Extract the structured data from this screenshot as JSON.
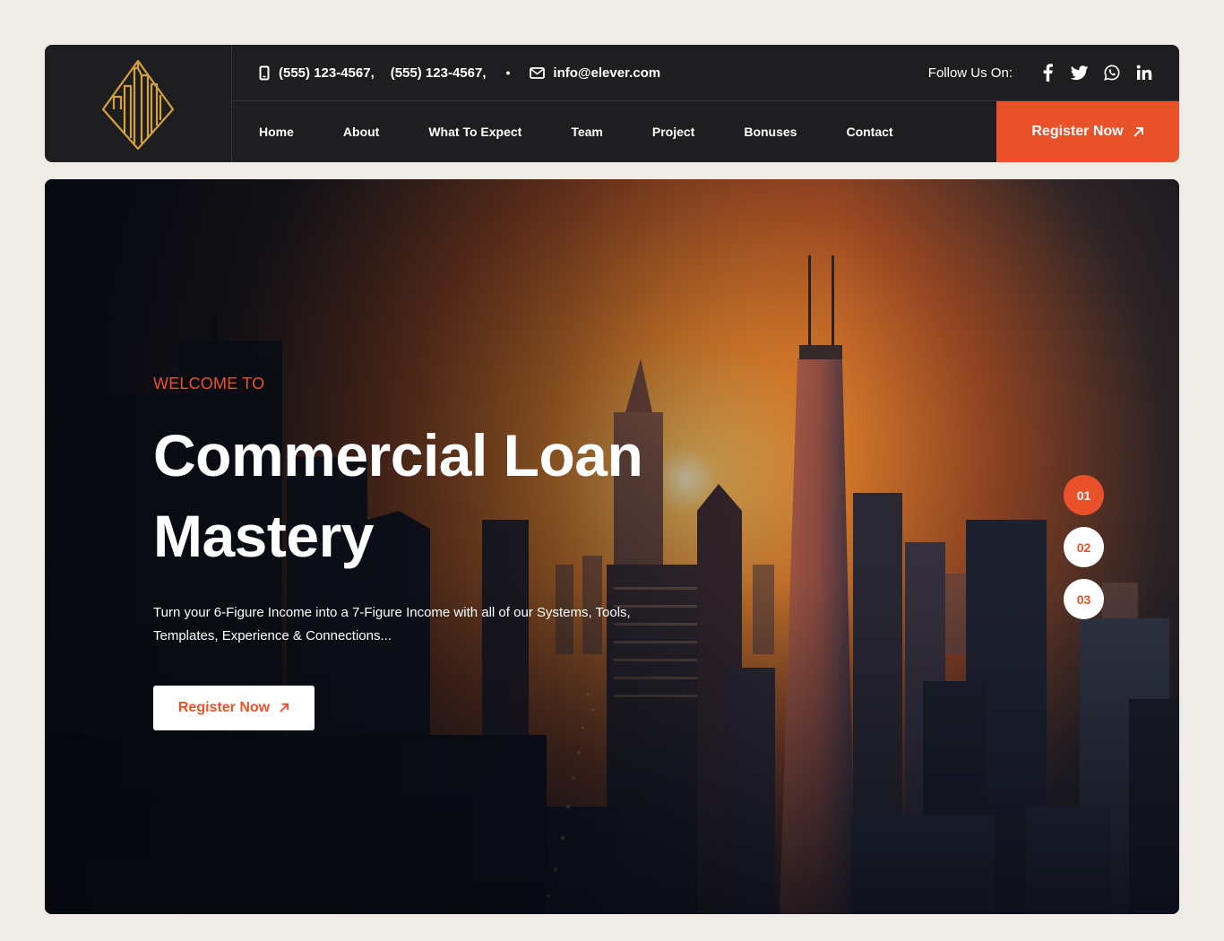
{
  "brand": {
    "logo": "gold-building-diamond-logo",
    "accent": "#e8512a",
    "dark": "#1e1e20",
    "gold": "#d4a13a"
  },
  "topbar": {
    "phone_icon": "phone-icon",
    "phone_1": "(555) 123-4567,",
    "phone_2": "(555) 123-4567,",
    "separator": "•",
    "mail_icon": "mail-icon",
    "email": "info@elever.com",
    "follow_label": "Follow Us On:",
    "social": [
      "facebook-icon",
      "twitter-icon",
      "whatsapp-icon",
      "linkedin-icon"
    ]
  },
  "nav": {
    "items": [
      {
        "label": "Home"
      },
      {
        "label": "About"
      },
      {
        "label": "What To Expect"
      },
      {
        "label": "Team"
      },
      {
        "label": "Project"
      },
      {
        "label": "Bonuses"
      },
      {
        "label": "Contact"
      }
    ],
    "cta_label": "Register Now"
  },
  "hero": {
    "kicker": "WELCOME TO",
    "title_line1": "Commercial Loan",
    "title_line2": "Mastery",
    "description": "Turn your 6-Figure Income into a 7-Figure Income with all of our Systems, Tools, Templates, Experience & Connections...",
    "button_label": "Register Now",
    "slides": [
      "01",
      "02",
      "03"
    ],
    "active_slide": "01"
  }
}
